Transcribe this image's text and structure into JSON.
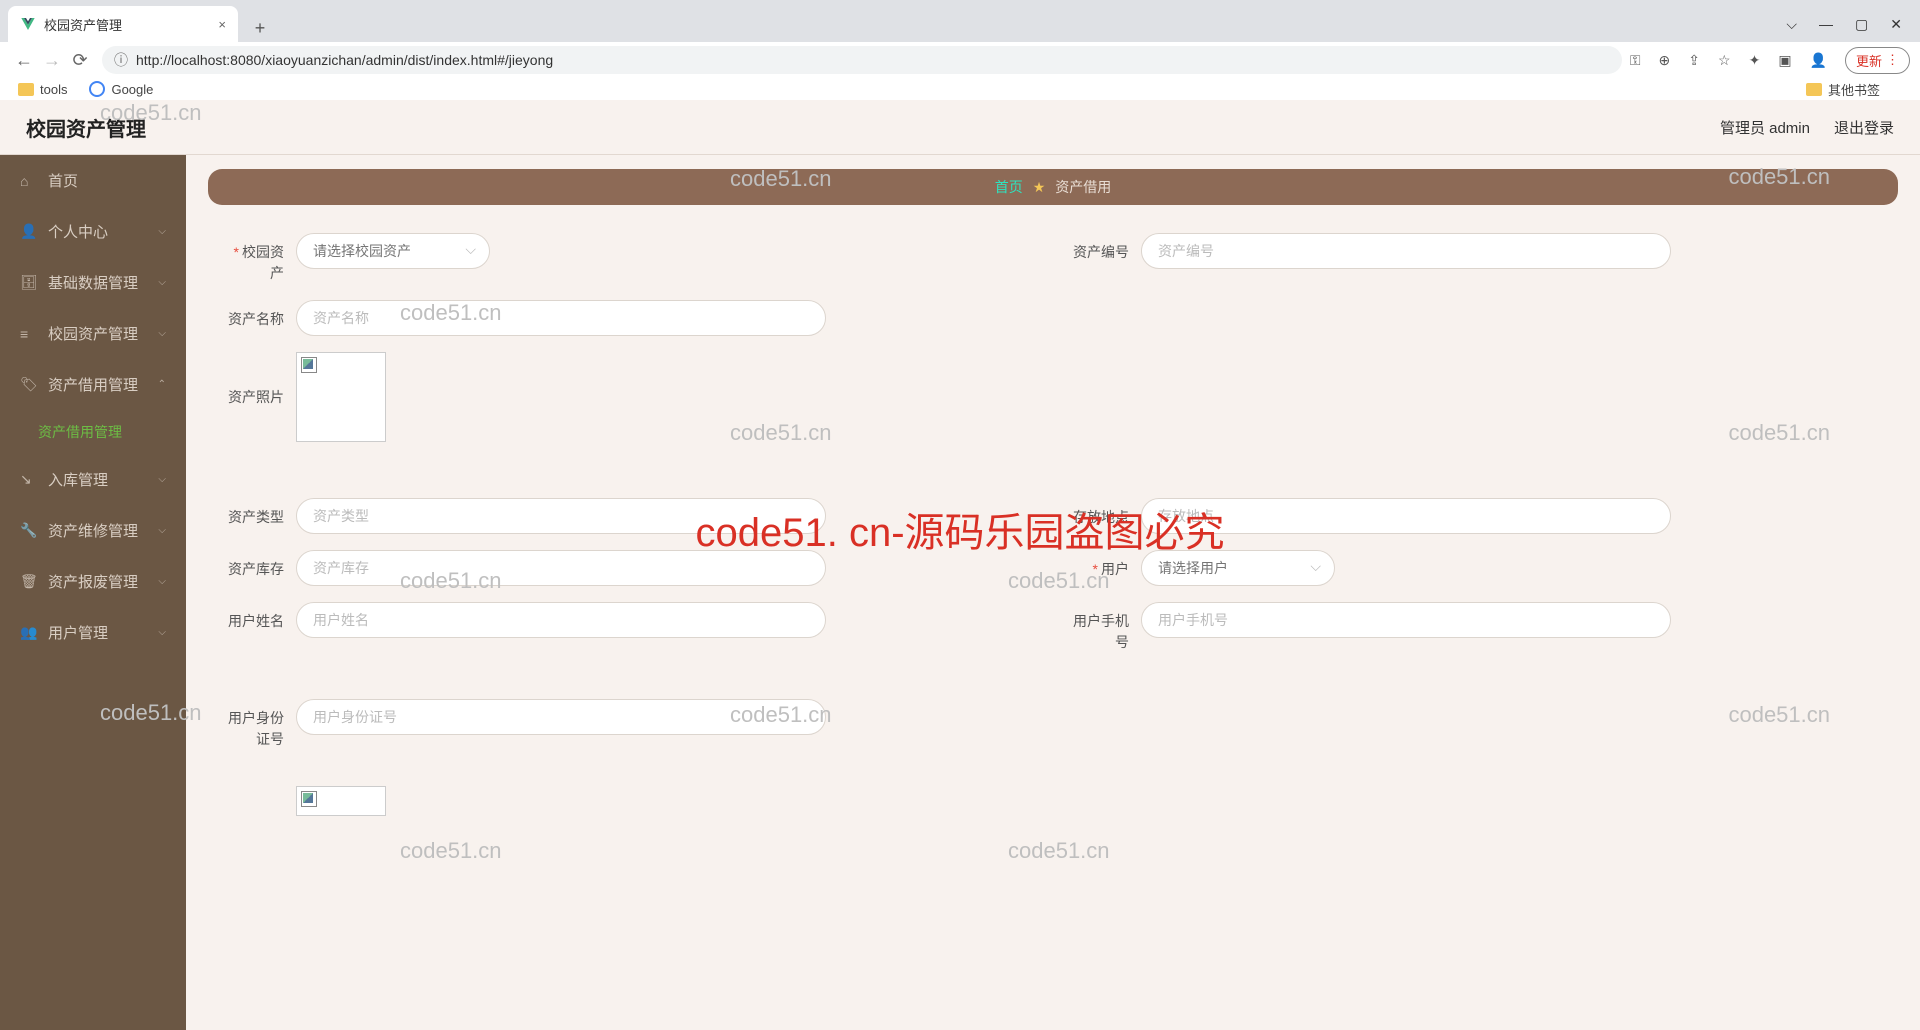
{
  "browser": {
    "tab_title": "校园资产管理",
    "url": "http://localhost:8080/xiaoyuanzichan/admin/dist/index.html#/jieyong",
    "update_btn": "更新",
    "bookmarks": {
      "tools": "tools",
      "google": "Google",
      "other": "其他书签"
    }
  },
  "header": {
    "title": "校园资产管理",
    "user_label": "管理员 admin",
    "logout": "退出登录"
  },
  "sidebar": {
    "items": [
      {
        "label": "首页",
        "icon": "⌂"
      },
      {
        "label": "个人中心",
        "icon": "👤"
      },
      {
        "label": "基础数据管理",
        "icon": "🗄"
      },
      {
        "label": "校园资产管理",
        "icon": "≡"
      },
      {
        "label": "资产借用管理",
        "icon": "🏷",
        "expanded": true
      },
      {
        "label": "入库管理",
        "icon": "↘"
      },
      {
        "label": "资产维修管理",
        "icon": "🔧"
      },
      {
        "label": "资产报废管理",
        "icon": "🗑"
      },
      {
        "label": "用户管理",
        "icon": "👥"
      }
    ],
    "sub_active": "资产借用管理"
  },
  "breadcrumb": {
    "home": "首页",
    "current": "资产借用"
  },
  "form": {
    "campus_asset": {
      "label": "校园资产",
      "placeholder": "请选择校园资产"
    },
    "asset_no": {
      "label": "资产编号",
      "placeholder": "资产编号"
    },
    "asset_name": {
      "label": "资产名称",
      "placeholder": "资产名称"
    },
    "asset_photo": {
      "label": "资产照片"
    },
    "asset_type": {
      "label": "资产类型",
      "placeholder": "资产类型"
    },
    "store_loc": {
      "label": "存放地点",
      "placeholder": "存放地点"
    },
    "asset_stock": {
      "label": "资产库存",
      "placeholder": "资产库存"
    },
    "user": {
      "label": "用户",
      "placeholder": "请选择用户"
    },
    "user_name": {
      "label": "用户姓名",
      "placeholder": "用户姓名"
    },
    "user_phone": {
      "label": "用户手机号",
      "placeholder": "用户手机号"
    },
    "user_idcard": {
      "label": "用户身份证号",
      "placeholder": "用户身份证号"
    }
  },
  "watermark": "code51.cn",
  "watermark_big": "code51. cn-源码乐园盗图必究"
}
